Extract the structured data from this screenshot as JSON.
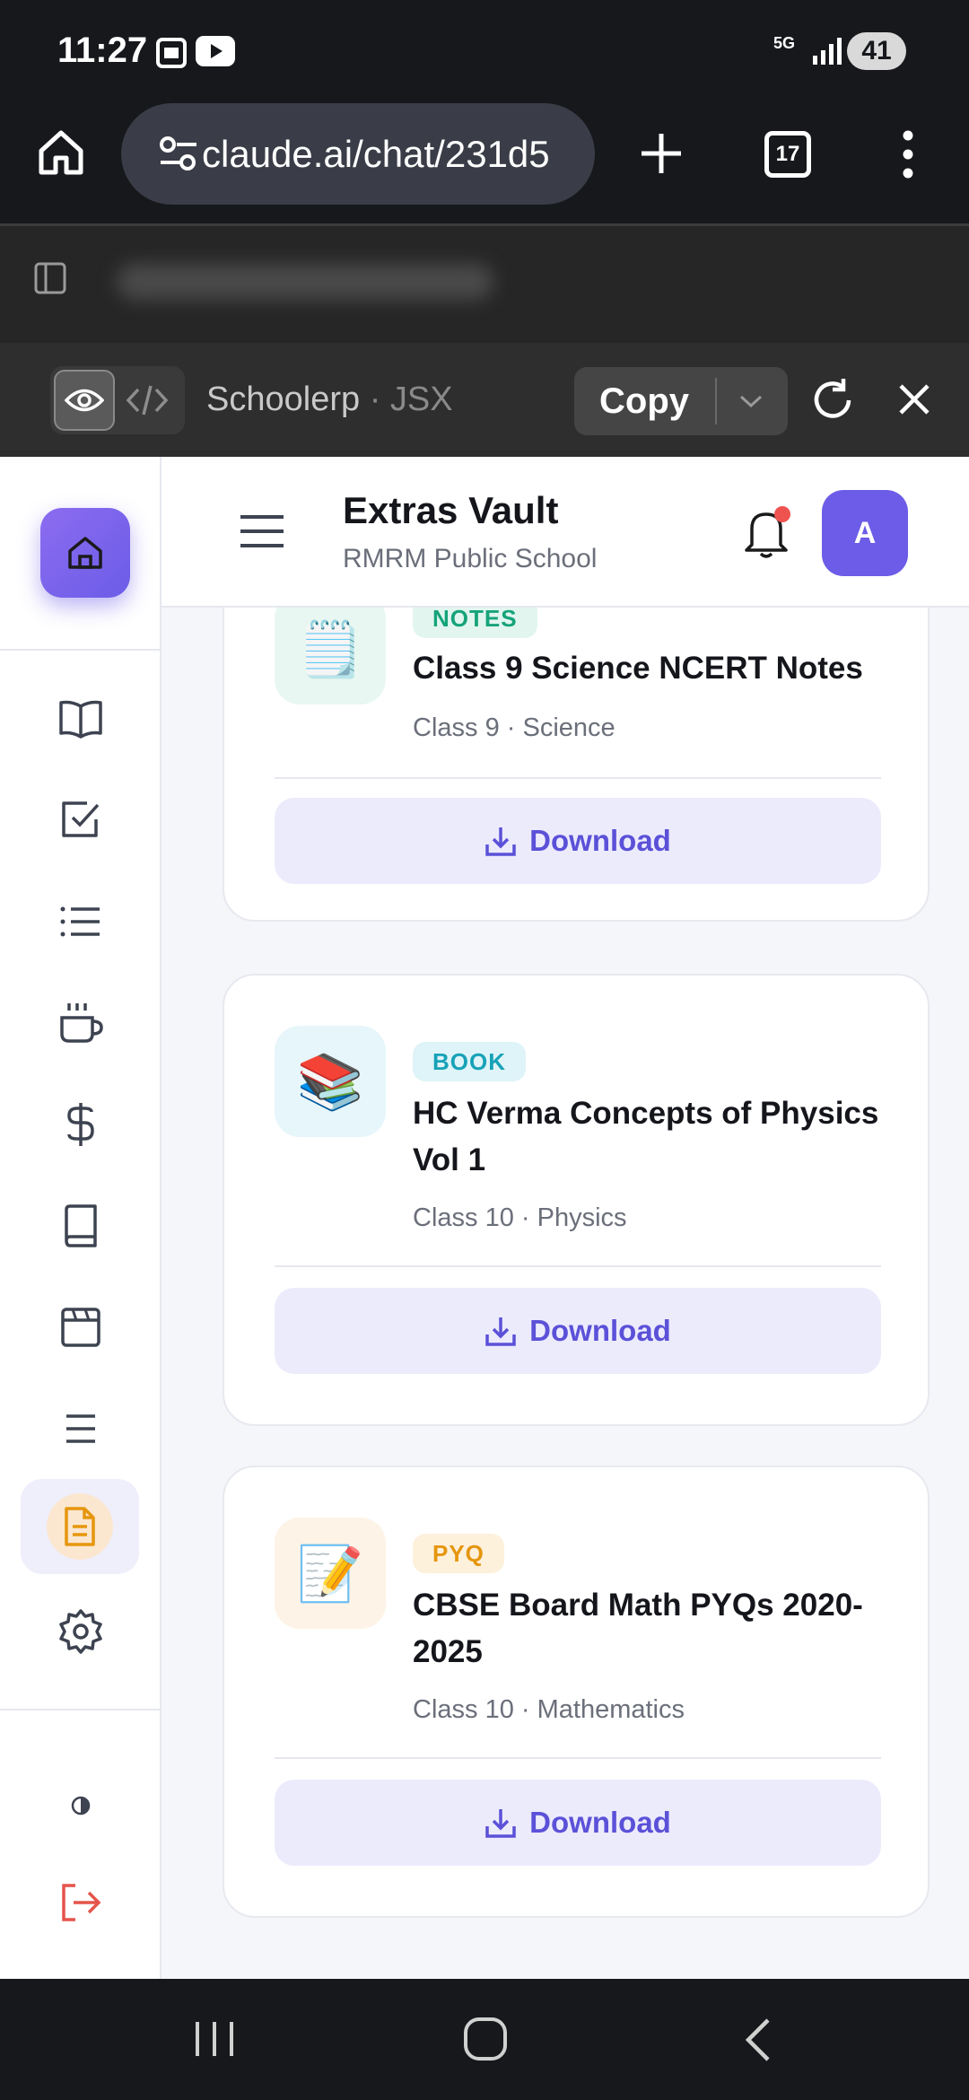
{
  "status_bar": {
    "time": "11:27",
    "network": "5G",
    "battery": "41"
  },
  "browser": {
    "url": "claude.ai/chat/231d5",
    "tab_count": "17"
  },
  "artifact_bar": {
    "name": "Schoolerp",
    "type": "JSX",
    "separator": "·",
    "copy_label": "Copy"
  },
  "app": {
    "title": "Extras Vault",
    "school": "RMRM Public School",
    "avatar_initial": "A",
    "accent": "#6c5ce7",
    "notification_dot_color": "#ef5350"
  },
  "items": [
    {
      "tag": "NOTES",
      "tag_color": "#16a37a",
      "tag_bg": "#e2f6ef",
      "thumb_bg": "#e8f7f1",
      "icon": "🗒️",
      "title": "Class 9 Science NCERT Notes",
      "meta": "Class 9 · Science",
      "button": "Download"
    },
    {
      "tag": "BOOK",
      "tag_color": "#17a2b8",
      "tag_bg": "#dff4f8",
      "thumb_bg": "#e6f6fa",
      "icon": "📚",
      "title": "HC Verma Concepts of Physics Vol 1",
      "meta": "Class 10 · Physics",
      "button": "Download"
    },
    {
      "tag": "PYQ",
      "tag_color": "#e6960d",
      "tag_bg": "#fdf1dc",
      "thumb_bg": "#fdf3e6",
      "icon": "📝",
      "title": "CBSE Board Math PYQs 2020-2025",
      "meta": "Class 10 · Mathematics",
      "button": "Download"
    }
  ]
}
